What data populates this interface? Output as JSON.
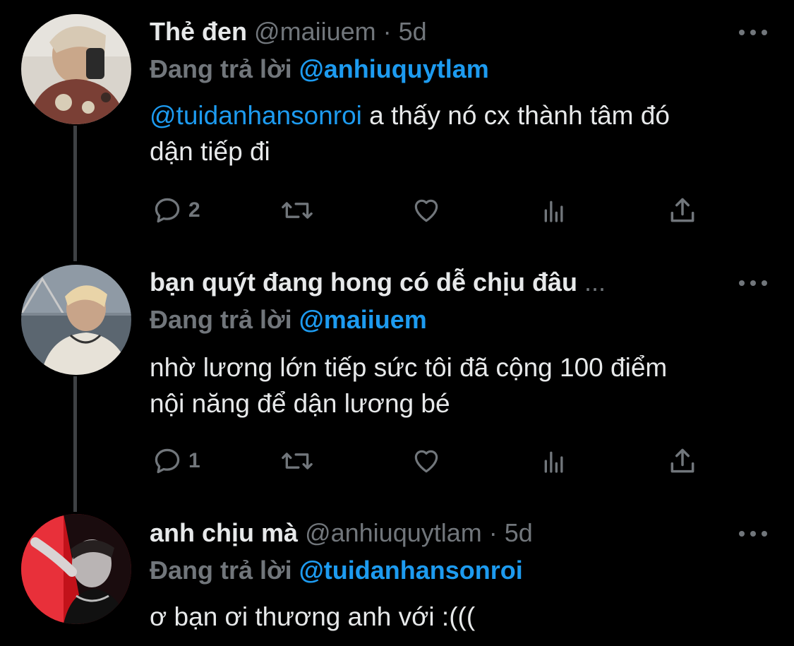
{
  "tweets": [
    {
      "display_name": "Thẻ đen",
      "handle": "@maiiuem",
      "separator": "·",
      "time": "5d",
      "reply_prefix": "Đang trả lời",
      "reply_to": "@anhiuquytlam",
      "body_mention": "@tuidanhansonroi",
      "body_text": " a thấy nó cx thành tâm đó\ndận tiếp đi",
      "reply_count": "2",
      "icons": [
        "reply-icon",
        "retweet-icon",
        "like-icon",
        "analytics-icon",
        "share-icon"
      ]
    },
    {
      "display_name": "bạn quýt đang hong có dễ chịu đâu",
      "ellipsis": "...",
      "reply_prefix": "Đang trả lời",
      "reply_to": "@maiiuem",
      "body_text": "nhờ lương lớn tiếp sức tôi đã cộng 100 điểm\nnội năng để dận lương bé",
      "reply_count": "1",
      "icons": [
        "reply-icon",
        "retweet-icon",
        "like-icon",
        "analytics-icon",
        "share-icon"
      ]
    },
    {
      "display_name": "anh chịu mà",
      "handle": "@anhiuquytlam",
      "separator": "·",
      "time": "5d",
      "reply_prefix": "Đang trả lời",
      "reply_to": "@tuidanhansonroi",
      "body_text": "ơ bạn ơi thương anh với :((("
    }
  ],
  "colors": {
    "background": "#000000",
    "text": "#e7e9ea",
    "muted": "#71767b",
    "accent": "#1d9bf0",
    "thread_line": "#3e4144"
  }
}
